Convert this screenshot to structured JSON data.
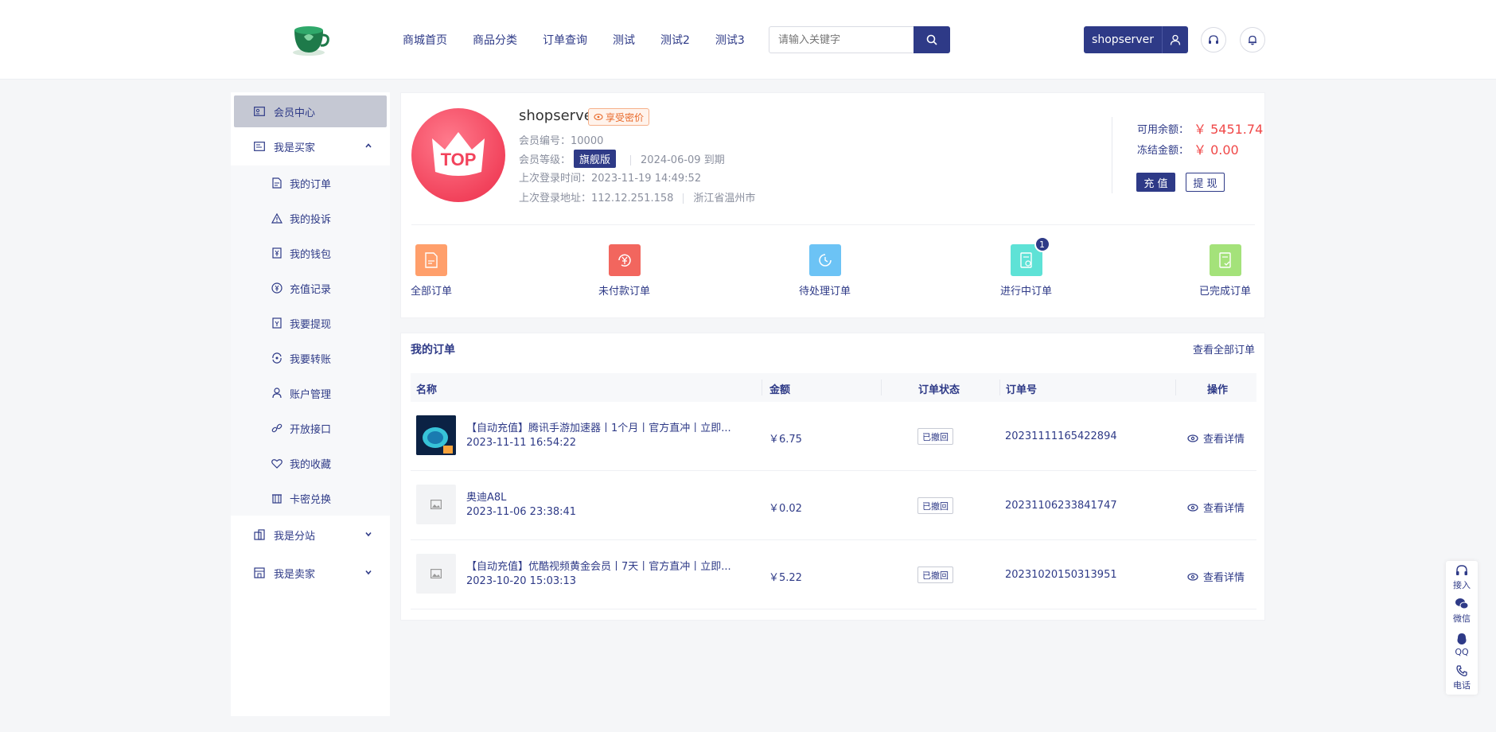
{
  "header": {
    "nav": [
      "商城首页",
      "商品分类",
      "订单查询",
      "测试",
      "测试2",
      "测试3"
    ],
    "search_placeholder": "请输入关键字",
    "user_name": "shopserver"
  },
  "sidebar": {
    "member_center": "会员中心",
    "buyer_group": "我是买家",
    "buyer_items": [
      "我的订单",
      "我的投诉",
      "我的钱包",
      "充值记录",
      "我要提现",
      "我要转账",
      "账户管理",
      "开放接口",
      "我的收藏",
      "卡密兑换"
    ],
    "substation_group": "我是分站",
    "seller_group": "我是卖家"
  },
  "profile": {
    "username": "shopserver",
    "vip_tag": "享受密价",
    "member_no_label": "会员编号：",
    "member_no": "10000",
    "level_label": "会员等级：",
    "level": "旗舰版",
    "expire": "2024-06-09 到期",
    "last_login_time_label": "上次登录时间：",
    "last_login_time": "2023-11-19 14:49:52",
    "last_login_addr_label": "上次登录地址：",
    "last_login_ip": "112.12.251.158",
    "last_login_region": "浙江省温州市",
    "avatar_text": "TOP",
    "available_label": "可用余额：",
    "available": "￥ 5451.74",
    "frozen_label": "冻结金额：",
    "frozen": "￥ 0.00",
    "recharge_btn": "充 值",
    "withdraw_btn": "提 现"
  },
  "shortcuts": [
    {
      "label": "全部订单",
      "color": "#ff9f6b"
    },
    {
      "label": "未付款订单",
      "color": "#f2665e"
    },
    {
      "label": "待处理订单",
      "color": "#6cc3f5"
    },
    {
      "label": "进行中订单",
      "color": "#5ee2d6",
      "badge": "1"
    },
    {
      "label": "已完成订单",
      "color": "#a4e27a"
    }
  ],
  "orders": {
    "title": "我的订单",
    "view_all": "查看全部订单",
    "columns": [
      "名称",
      "金额",
      "订单状态",
      "订单号",
      "操作"
    ],
    "rows": [
      {
        "name": "【自动充值】腾讯手游加速器丨1个月丨官方直冲丨立即...",
        "date": "2023-11-11 16:54:22",
        "amount": "￥6.75",
        "status": "已撤回",
        "order_no": "20231111165422894",
        "action": "查看详情",
        "thumb": "image"
      },
      {
        "name": "奥迪A8L",
        "date": "2023-11-06 23:38:41",
        "amount": "￥0.02",
        "status": "已撤回",
        "order_no": "20231106233841747",
        "action": "查看详情",
        "thumb": "placeholder"
      },
      {
        "name": "【自动充值】优酷视频黄金会员丨7天丨官方直冲丨立即...",
        "date": "2023-10-20 15:03:13",
        "amount": "￥5.22",
        "status": "已撤回",
        "order_no": "20231020150313951",
        "action": "查看详情",
        "thumb": "placeholder"
      }
    ]
  },
  "float_bar": [
    "接入",
    "微信",
    "QQ",
    "电话"
  ]
}
